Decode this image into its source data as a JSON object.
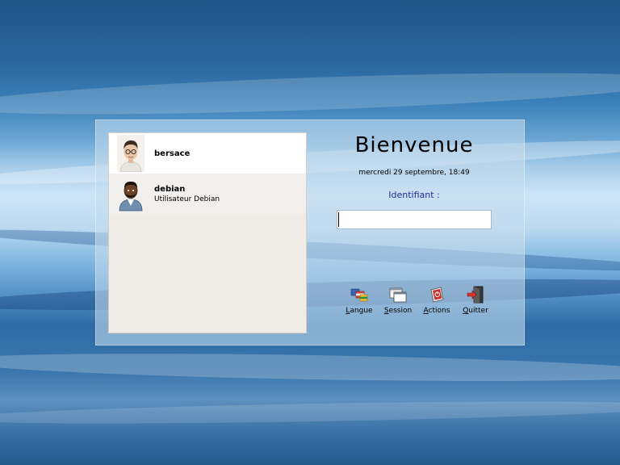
{
  "window": {
    "greeting": "Bienvenue",
    "clock": "mercredi 29 septembre, 18:49"
  },
  "users": [
    {
      "name": "bersace",
      "description": "",
      "avatar": "photo-avatar",
      "selected": true
    },
    {
      "name": "debian",
      "description": "Utilisateur Debian",
      "avatar": "default-user-icon",
      "selected": false
    }
  ],
  "login": {
    "label": "Identifiant :",
    "value": ""
  },
  "actions": [
    {
      "id": "language",
      "mnemonic": "L",
      "rest": "angue",
      "icon": "language-flags-icon"
    },
    {
      "id": "session",
      "mnemonic": "S",
      "rest": "ession",
      "icon": "session-windows-icon"
    },
    {
      "id": "actions",
      "mnemonic": "A",
      "rest": "ctions",
      "icon": "actions-power-icon"
    },
    {
      "id": "quit",
      "mnemonic": "Q",
      "rest": "uitter",
      "icon": "quit-door-icon"
    }
  ],
  "colors": {
    "label_text": "#1c2f9a",
    "list_background": "#efebe7",
    "selected_row": "#ffffff"
  }
}
